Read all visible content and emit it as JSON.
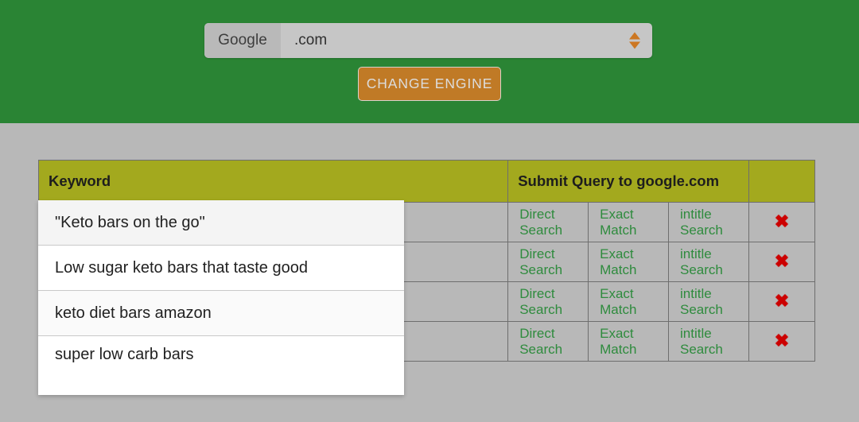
{
  "header": {
    "background_color": "#2a8434",
    "engine_prefix_label": "Google",
    "engine_domain_value": ".com",
    "engine_domain_placeholder": ".com",
    "spinner_icon": "up-down-arrow-icon",
    "spinner_color": "#cc7722",
    "change_engine_label": "CHANGE ENGINE",
    "change_engine_color": "#c07a26"
  },
  "table": {
    "header_color": "#a3a91e",
    "link_color": "#2e8b3d",
    "delete_color": "#cc0000",
    "columns": [
      {
        "key": "keyword",
        "label": "Keyword"
      },
      {
        "key": "submit",
        "label": "Submit Query to google.com"
      },
      {
        "key": "blank",
        "label": ""
      }
    ],
    "action_labels": {
      "direct": "Direct Search",
      "direct_visible": "t Search",
      "exact": "Exact Match",
      "intitle": "intitle Search",
      "delete_icon": "✖"
    },
    "rows": [
      {
        "keyword": "\"Keto bars on the go\"",
        "direct": "Direct Search",
        "direct_visible": "t Search",
        "exact": "Exact Match",
        "intitle": "intitle Search",
        "delete": "✖"
      },
      {
        "keyword": "Low sugar keto bars that taste good",
        "direct": "Direct Search",
        "direct_visible": "t Search",
        "exact": "Exact Match",
        "intitle": "intitle Search",
        "delete": "✖"
      },
      {
        "keyword": "keto diet bars amazon",
        "direct": "Direct Search",
        "direct_visible": "t Search",
        "exact": "Exact Match",
        "intitle": "intitle Search",
        "delete": "✖"
      },
      {
        "keyword": "super low carb bars",
        "direct": "Direct Search",
        "direct_visible": "t Search",
        "exact": "Exact Match",
        "intitle": "intitle Search",
        "delete": "✖"
      }
    ]
  },
  "keyword_overlay": {
    "items": [
      {
        "label": "\"Keto bars on the go\""
      },
      {
        "label": "Low sugar keto bars that taste good"
      },
      {
        "label": "keto diet bars amazon"
      },
      {
        "label": "super low carb bars"
      }
    ]
  }
}
